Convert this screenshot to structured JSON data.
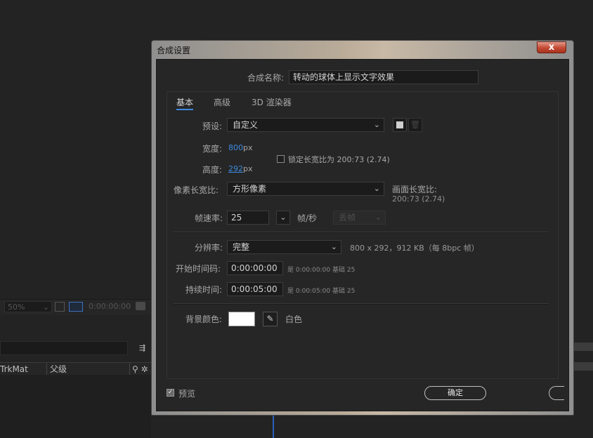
{
  "background": {
    "zoom_value": "50%",
    "timecode": "0:00:00:00",
    "columns": [
      "TrkMat",
      "父级"
    ]
  },
  "dialog": {
    "title": "合成设置",
    "close_symbol": "x",
    "comp_name_label": "合成名称:",
    "comp_name_value": "转动的球体上显示文字效果",
    "tabs": [
      "基本",
      "高级",
      "3D 渲染器"
    ],
    "active_tab": "基本",
    "preset_label": "预设:",
    "preset_value": "自定义",
    "width_label": "宽度:",
    "width_value": "800",
    "height_label": "高度:",
    "height_value": "292",
    "unit_px": "px",
    "lock_aspect_label": "锁定长宽比为 200:73 (2.74)",
    "lock_aspect_checked": false,
    "pixel_aspect_label": "像素长宽比:",
    "pixel_aspect_value": "方形像素",
    "frame_aspect_label": "画面长宽比:",
    "frame_aspect_value": "200:73 (2.74)",
    "frame_rate_label": "帧速率:",
    "frame_rate_value": "25",
    "fps_unit": "帧/秒",
    "drop_frame_value": "丢帧",
    "resolution_label": "分辨率:",
    "resolution_value": "完整",
    "resolution_info": "800 x 292，912 KB（每 8bpc 帧）",
    "start_tc_label": "开始时间码:",
    "start_tc_value": "0:00:00:00",
    "start_tc_info": "是 0:00:00:00",
    "start_tc_base": "基础 25",
    "duration_label": "持续时间:",
    "duration_value": "0:00:05:00",
    "duration_info": "是 0:00:05:00",
    "duration_base": "基础 25",
    "bg_color_label": "背景颜色:",
    "bg_color_hex": "#FFFFFF",
    "bg_color_name": "白色",
    "preview_label": "预览",
    "preview_checked": true,
    "ok_label": "确定"
  },
  "colors": {
    "accent_link": "#3d8ae0",
    "close_red": "#c44a33"
  }
}
